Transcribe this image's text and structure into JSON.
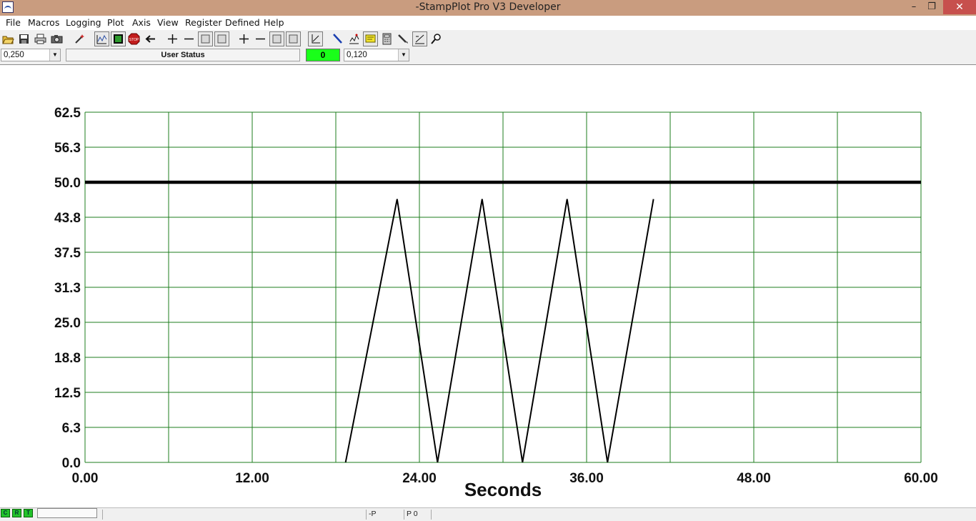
{
  "window": {
    "title": "-StampPlot Pro V3 Developer",
    "minimize_icon": "minimize-icon",
    "restore_icon": "restore-icon",
    "close_icon": "close-icon",
    "minimize_glyph": "–",
    "restore_glyph": "❐",
    "close_glyph": "✕"
  },
  "menu": [
    "File",
    "Macros",
    "Logging",
    "Plot",
    "Axis",
    "View",
    "Register",
    "Defined",
    "Help"
  ],
  "toolbar": {
    "icons": [
      "open-folder-icon",
      "save-icon",
      "print-icon",
      "camera-icon",
      "wand-icon",
      "plot-icon",
      "monitor-icon",
      "stop-icon",
      "back-arrow-icon",
      "plus-icon",
      "minus-icon",
      "page-icon",
      "page-icon",
      "plus-icon",
      "minus-icon",
      "page-icon",
      "page-icon",
      "axis-icon",
      "pen-icon",
      "chart-icon",
      "note-icon",
      "calculator-icon",
      "pencil-icon",
      "graph-icon",
      "magnify-icon"
    ],
    "stop_label": "STOP"
  },
  "controls": {
    "left_combo_value": "0,250",
    "user_status": "User Status",
    "counter": "0",
    "right_combo_value": "0,120",
    "counter_color": "#1aff1a"
  },
  "chart_data": {
    "type": "line",
    "title": "",
    "xlabel": "Seconds",
    "ylabel": "",
    "xlim": [
      0,
      60
    ],
    "ylim": [
      0,
      62.5
    ],
    "x_ticks": [
      "0.00",
      "12.00",
      "24.00",
      "36.00",
      "48.00",
      "60.00"
    ],
    "y_ticks": [
      "0.0",
      "6.3",
      "12.5",
      "18.8",
      "25.0",
      "31.3",
      "37.5",
      "43.8",
      "50.0",
      "56.3",
      "62.5"
    ],
    "grid": true,
    "grid_color": "#1e7d1e",
    "series": [
      {
        "name": "",
        "color": "#000000",
        "x": [
          0,
          60
        ],
        "y": [
          50,
          50
        ],
        "width": "thick"
      },
      {
        "name": "",
        "color": "#000000",
        "x": [
          18.7,
          22.4,
          25.3,
          28.5,
          31.4,
          34.6,
          37.5,
          40.8
        ],
        "y": [
          0,
          47.0,
          0,
          47.0,
          0,
          47.0,
          0,
          47.0
        ],
        "width": "thin"
      }
    ]
  },
  "statusbar": {
    "leds": [
      "C",
      "R",
      "T"
    ],
    "led_color": "#22c22a",
    "slot1": "-P",
    "slot2": "P 0"
  }
}
